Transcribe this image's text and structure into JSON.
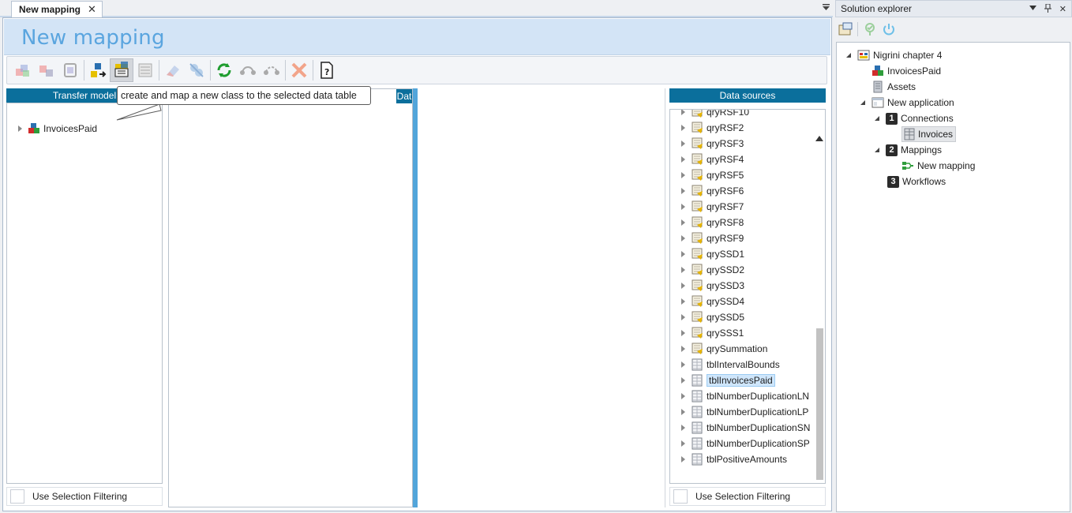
{
  "document_tab": {
    "label": "New mapping"
  },
  "title": "New mapping",
  "toolbar": {
    "buttons": [
      "add-class",
      "add-field",
      "database",
      "map-class",
      "create-map-class",
      "table-mapping",
      "eraser",
      "unlink",
      "refresh",
      "connect",
      "disconnect",
      "delete-mapping",
      "help"
    ]
  },
  "tooltip": "create and map a new class to the selected data table",
  "transfer_model": {
    "header": "Transfer model",
    "items": [
      {
        "label": "InvoicesPaid"
      }
    ],
    "filter_label": "Use Selection Filtering"
  },
  "data_panel": {
    "header": "Dat"
  },
  "data_sources": {
    "header": "Data sources",
    "items": [
      {
        "label": "qryRSF10",
        "kind": "query"
      },
      {
        "label": "qryRSF2",
        "kind": "query"
      },
      {
        "label": "qryRSF3",
        "kind": "query"
      },
      {
        "label": "qryRSF4",
        "kind": "query"
      },
      {
        "label": "qryRSF5",
        "kind": "query"
      },
      {
        "label": "qryRSF6",
        "kind": "query"
      },
      {
        "label": "qryRSF7",
        "kind": "query"
      },
      {
        "label": "qryRSF8",
        "kind": "query"
      },
      {
        "label": "qryRSF9",
        "kind": "query"
      },
      {
        "label": "qrySSD1",
        "kind": "query"
      },
      {
        "label": "qrySSD2",
        "kind": "query"
      },
      {
        "label": "qrySSD3",
        "kind": "query"
      },
      {
        "label": "qrySSD4",
        "kind": "query"
      },
      {
        "label": "qrySSD5",
        "kind": "query"
      },
      {
        "label": "qrySSS1",
        "kind": "query"
      },
      {
        "label": "qrySummation",
        "kind": "query"
      },
      {
        "label": "tblIntervalBounds",
        "kind": "table"
      },
      {
        "label": "tblInvoicesPaid",
        "kind": "table",
        "selected": true
      },
      {
        "label": "tblNumberDuplicationLN",
        "kind": "table"
      },
      {
        "label": "tblNumberDuplicationLP",
        "kind": "table"
      },
      {
        "label": "tblNumberDuplicationSN",
        "kind": "table"
      },
      {
        "label": "tblNumberDuplicationSP",
        "kind": "table"
      },
      {
        "label": "tblPositiveAmounts",
        "kind": "table"
      }
    ],
    "filter_label": "Use Selection Filtering"
  },
  "solution_explorer": {
    "title": "Solution explorer",
    "nodes": [
      {
        "label": "Nigrini chapter 4"
      },
      {
        "label": "InvoicesPaid"
      },
      {
        "label": "Assets"
      },
      {
        "label": "New application"
      },
      {
        "label": "Connections",
        "badge": "1"
      },
      {
        "label": "Invoices"
      },
      {
        "label": "Mappings",
        "badge": "2"
      },
      {
        "label": "New mapping"
      },
      {
        "label": "Workflows",
        "badge": "3"
      }
    ]
  },
  "colors": {
    "panel_header": "#0b6f9c",
    "title_text": "#5aa5df",
    "title_band": "#d3e4f6",
    "splitter": "#52a5da"
  }
}
